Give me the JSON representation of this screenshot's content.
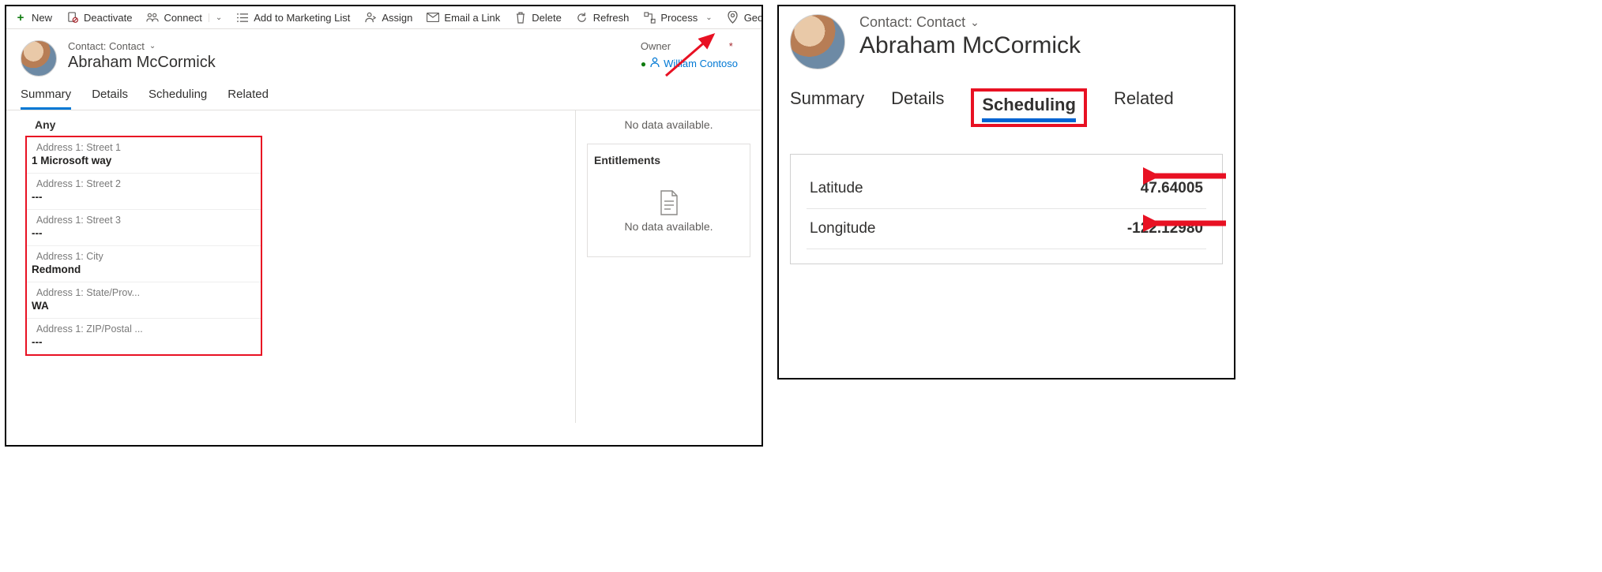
{
  "left": {
    "commands": {
      "new": "New",
      "deactivate": "Deactivate",
      "connect": "Connect",
      "add_to_marketing": "Add to Marketing List",
      "assign": "Assign",
      "email_link": "Email a Link",
      "delete": "Delete",
      "refresh": "Refresh",
      "process": "Process",
      "geo_code": "Geo Code"
    },
    "breadcrumb": "Contact: Contact",
    "record_name": "Abraham McCormick",
    "owner_label": "Owner",
    "owner_name": "William Contoso",
    "tabs": {
      "summary": "Summary",
      "details": "Details",
      "scheduling": "Scheduling",
      "related": "Related"
    },
    "any_label": "Any",
    "address": {
      "street1_label": "Address 1: Street 1",
      "street1_value": "1 Microsoft way",
      "street2_label": "Address 1: Street 2",
      "street2_value": "---",
      "street3_label": "Address 1: Street 3",
      "street3_value": "---",
      "city_label": "Address 1: City",
      "city_value": "Redmond",
      "state_label": "Address 1: State/Prov...",
      "state_value": "WA",
      "zip_label": "Address 1: ZIP/Postal ...",
      "zip_value": "---"
    },
    "no_data": "No data available.",
    "entitlements": "Entitlements"
  },
  "right": {
    "breadcrumb": "Contact: Contact",
    "record_name": "Abraham McCormick",
    "tabs": {
      "summary": "Summary",
      "details": "Details",
      "scheduling": "Scheduling",
      "related": "Related"
    },
    "latitude_label": "Latitude",
    "latitude_value": "47.64005",
    "longitude_label": "Longitude",
    "longitude_value": "-122.12980"
  }
}
